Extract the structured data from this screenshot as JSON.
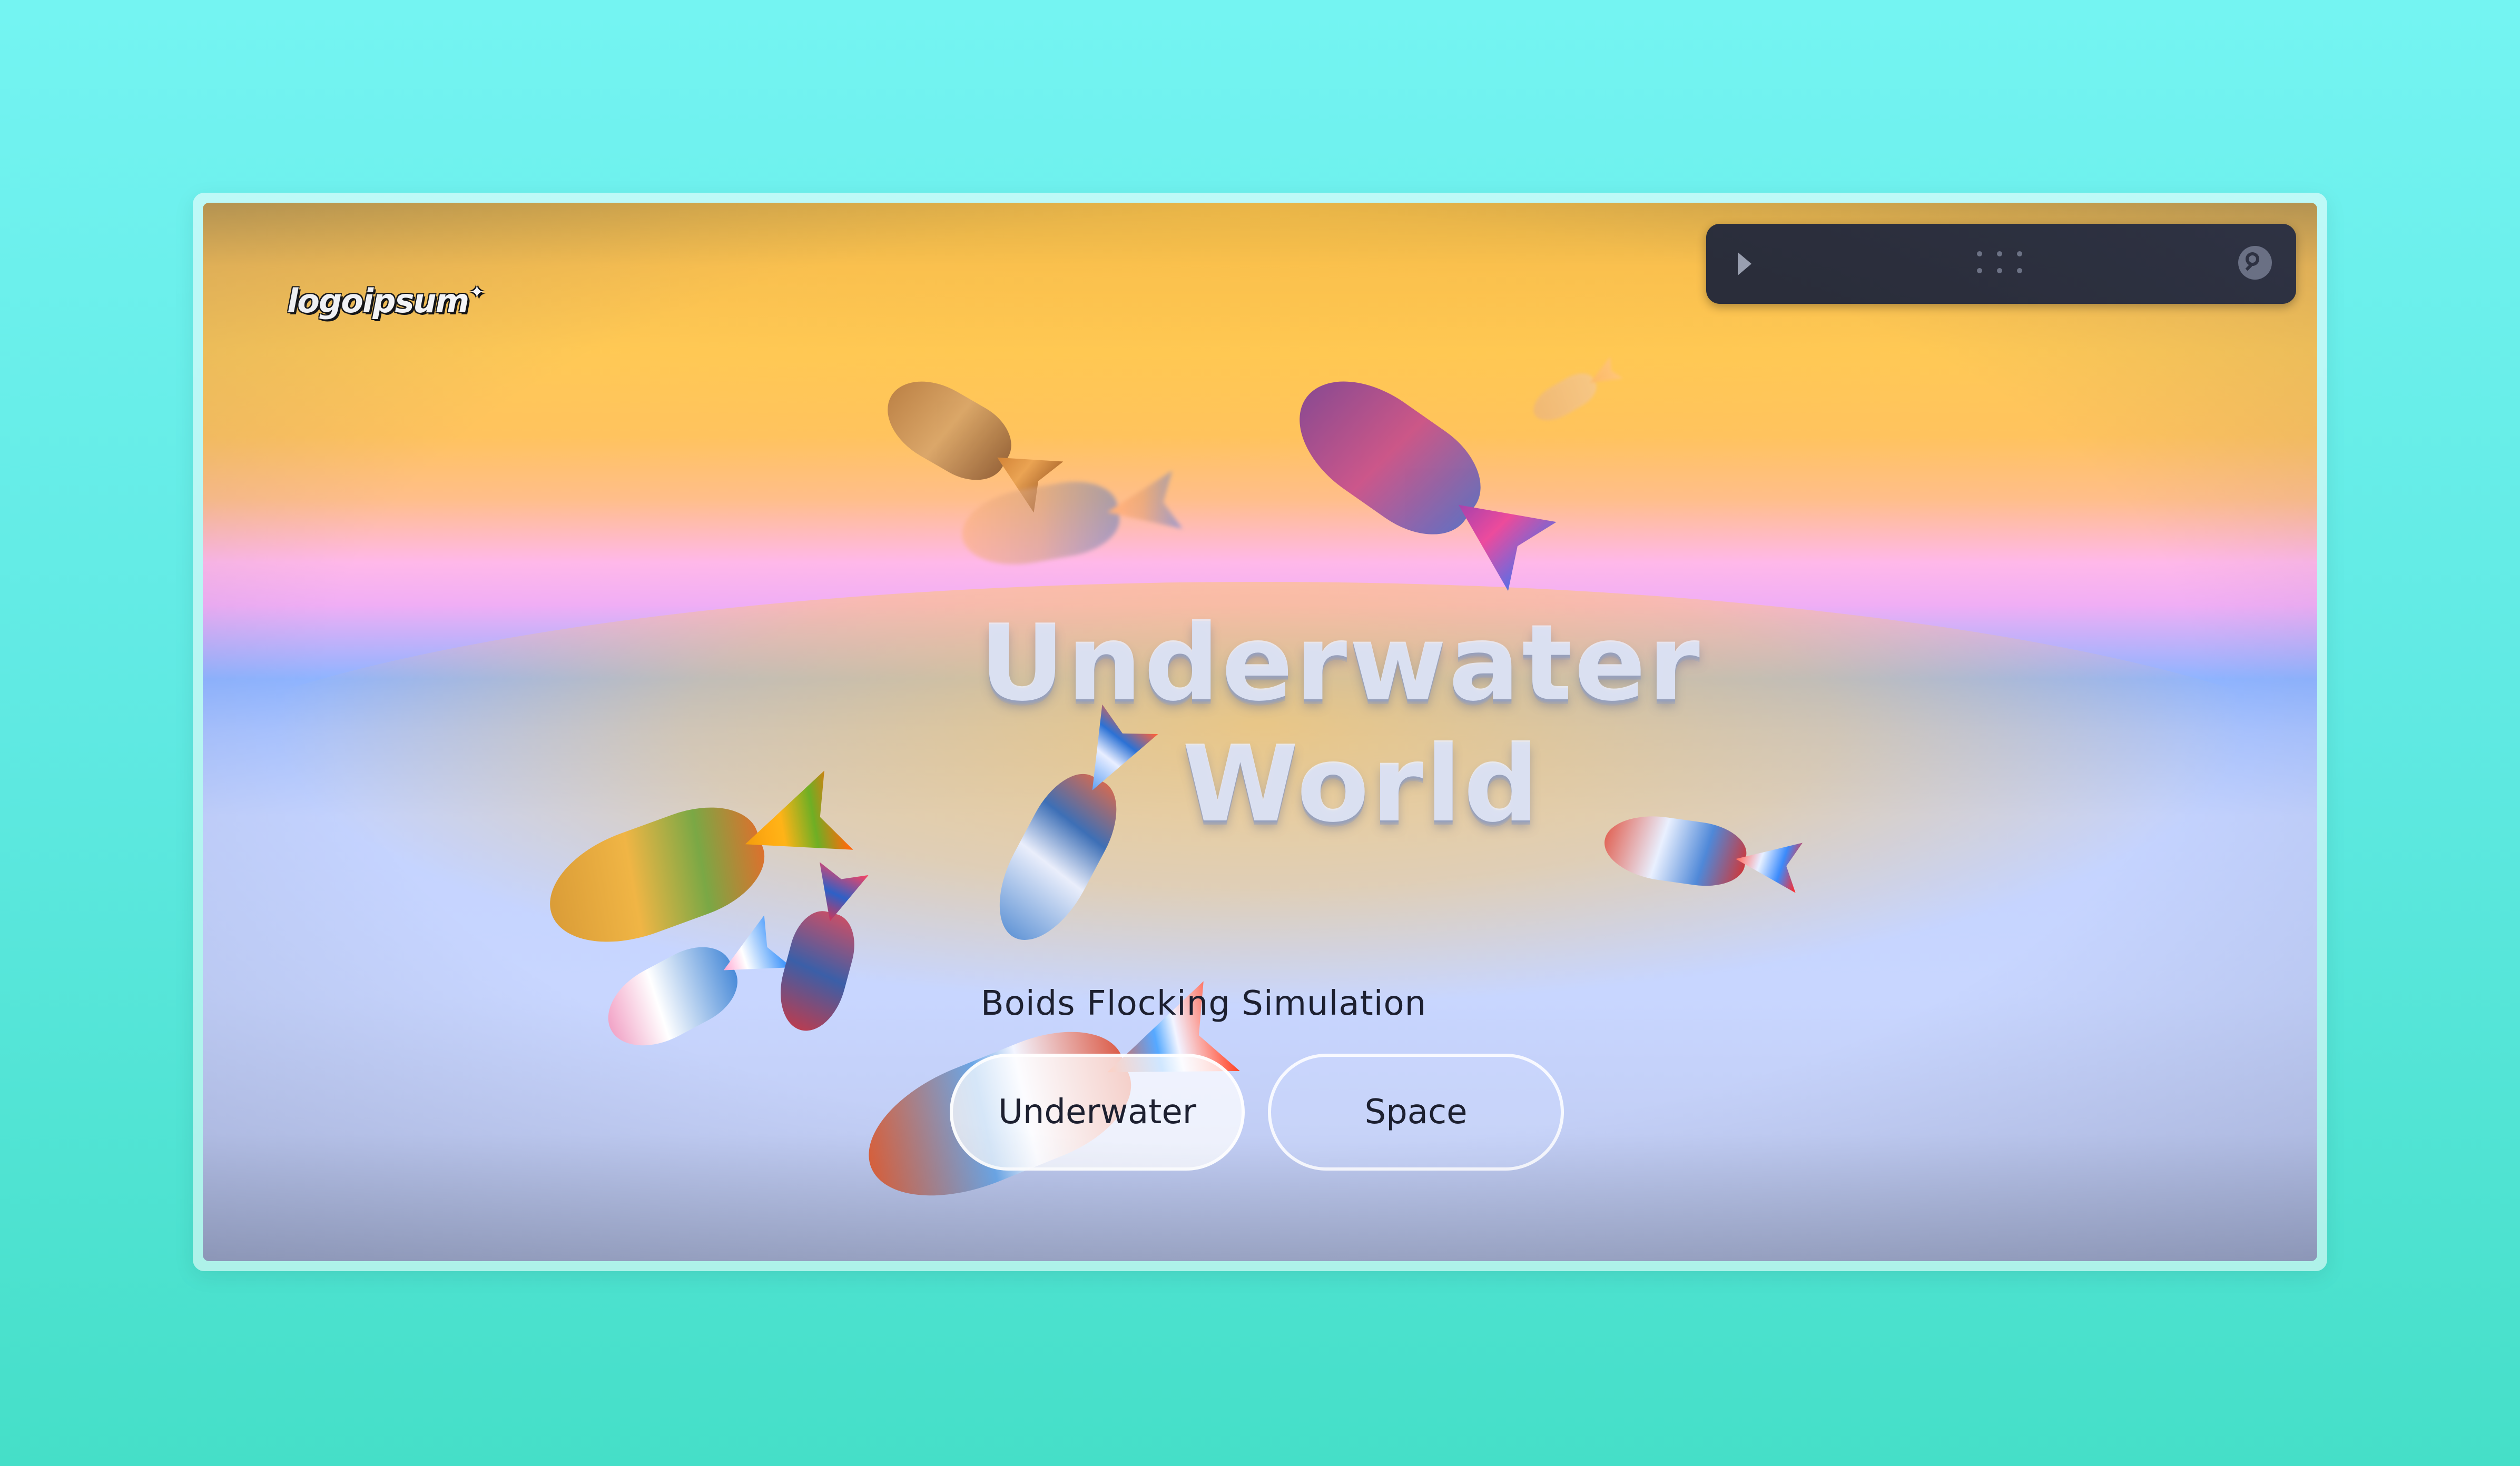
{
  "brand": {
    "logo_text": "logoipsum",
    "logo_star": "✦"
  },
  "toolbar": {
    "play_icon": "play-icon",
    "grip_icon": "drag-handle-icon",
    "search_icon": "search-icon"
  },
  "scene": {
    "title_line1": "Underwater",
    "title_line2": "World",
    "subtitle": "Boids Flocking Simulation"
  },
  "modes": {
    "underwater_label": "Underwater",
    "space_label": "Space",
    "selected": "Underwater"
  },
  "colors": {
    "page_background": "#5fe9e2",
    "toolbar_background": "#2a2d3a",
    "sky_yellow": "#ffc956",
    "horizon_pink": "#ffb8e9",
    "water_blue": "#c8d6ff"
  }
}
